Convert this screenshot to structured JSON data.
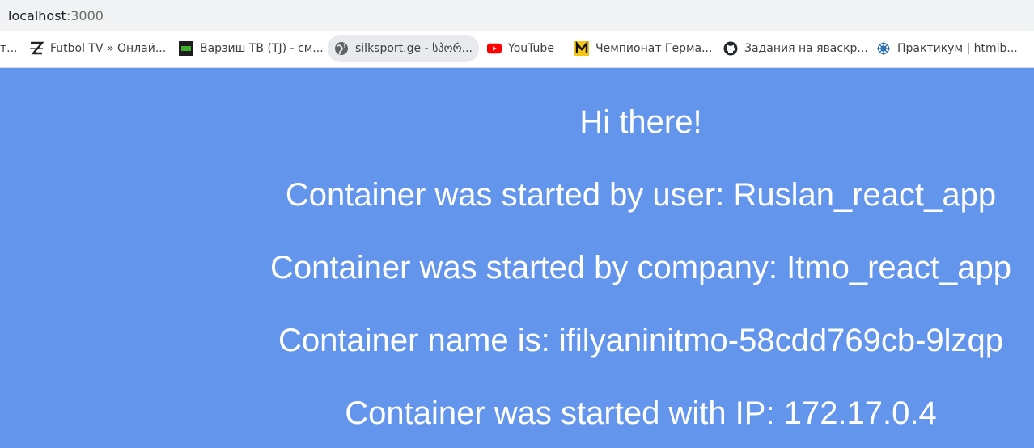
{
  "browser": {
    "url_host": "localhost",
    "url_port": ":3000"
  },
  "bookmarks": [
    {
      "label": "т...",
      "icon": "favicon-cut"
    },
    {
      "label": "Futbol TV » Онлай...",
      "icon": "z-logo-icon"
    },
    {
      "label": "Варзиш ТВ (TJ) - см...",
      "icon": "varzish-icon"
    },
    {
      "label": "silksport.ge - სპორ...",
      "icon": "globe-icon"
    },
    {
      "label": "YouTube",
      "icon": "youtube-icon"
    },
    {
      "label": "Чемпионат Герма...",
      "icon": "m-logo-icon"
    },
    {
      "label": "Задания на яваскр...",
      "icon": "github-icon"
    },
    {
      "label": "Практикум | htmlb...",
      "icon": "web-icon"
    }
  ],
  "content": {
    "greeting": "Hi there!",
    "user_line": "Container was started by user: Ruslan_react_app",
    "company_line": "Container was started by company: Itmo_react_app",
    "name_line": "Container name is: ifilyaninitmo-58cdd769cb-9lzqp",
    "ip_line": "Container was started with IP: 172.17.0.4"
  },
  "colors": {
    "page_background": "#6495ed",
    "text": "#ffffff"
  }
}
